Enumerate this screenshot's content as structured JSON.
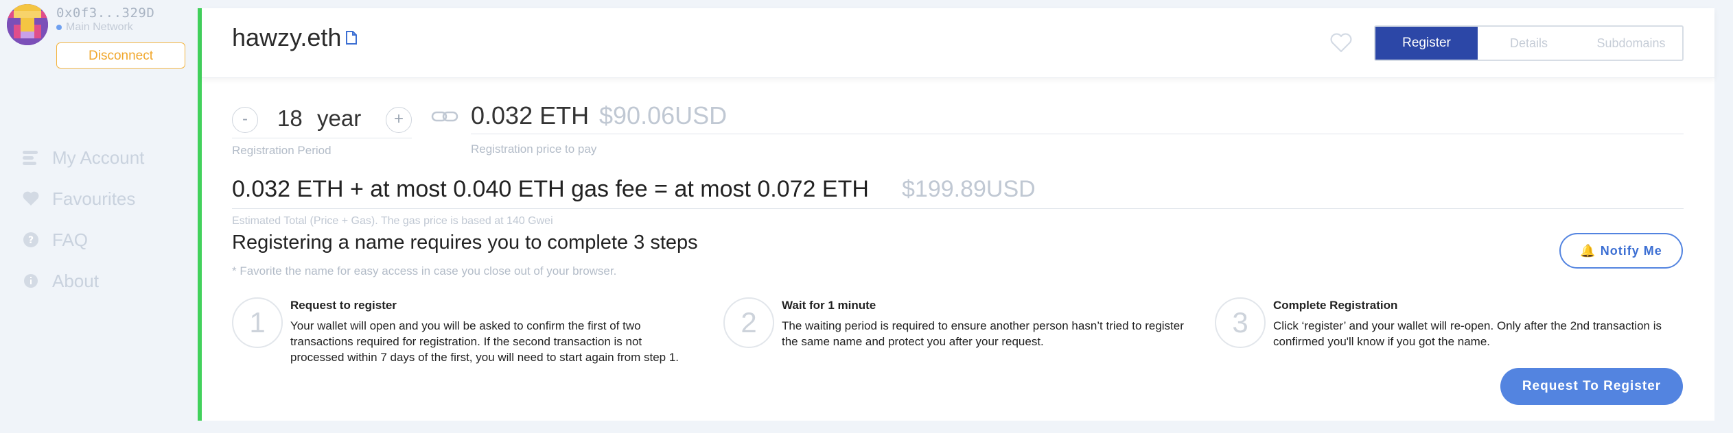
{
  "account": {
    "address": "0x0f3...329D",
    "network": "Main Network",
    "disconnect_label": "Disconnect"
  },
  "nav": {
    "items": [
      {
        "label": "My Account",
        "icon": "account-icon"
      },
      {
        "label": "Favourites",
        "icon": "heart-icon"
      },
      {
        "label": "FAQ",
        "icon": "question-icon"
      },
      {
        "label": "About",
        "icon": "info-icon"
      }
    ]
  },
  "domain": {
    "name": "hawzy.eth"
  },
  "tabs": [
    {
      "label": "Register",
      "active": true
    },
    {
      "label": "Details",
      "active": false
    },
    {
      "label": "Subdomains",
      "active": false
    }
  ],
  "registration": {
    "minus_label": "-",
    "plus_label": "+",
    "years": "18",
    "unit": "year",
    "period_label": "Registration Period",
    "price_eth": "0.032 ETH",
    "price_usd": "$90.06USD",
    "price_label": "Registration price to pay",
    "total_text": "0.032 ETH + at most 0.040 ETH gas fee = at most 0.072 ETH",
    "total_usd": "$199.89USD",
    "total_label": "Estimated Total (Price + Gas). The gas price is based at 140 Gwei"
  },
  "steps_section": {
    "title": "Registering a name requires you to complete 3 steps",
    "note": "* Favorite the name for easy access in case you close out of your browser.",
    "notify_label": "Notify Me",
    "steps": [
      {
        "num": "1",
        "title": "Request to register",
        "desc": "Your wallet will open and you will be asked to confirm the first of two transactions required for registration. If the second transaction is not processed within 7 days of the first, you will need to start again from step 1."
      },
      {
        "num": "2",
        "title": "Wait for 1 minute",
        "desc": "The waiting period is required to ensure another person hasn’t tried to register the same name and protect you after your request."
      },
      {
        "num": "3",
        "title": "Complete Registration",
        "desc": "Click ‘register’ and your wallet will re-open. Only after the 2nd transaction is confirmed you'll know if you got the name."
      }
    ],
    "cta_label": "Request To Register"
  },
  "colors": {
    "accent_blue": "#2c47a7",
    "button_blue": "#5384e0",
    "green_bar": "#42d15c",
    "disconnect_orange": "#f1a72c"
  }
}
